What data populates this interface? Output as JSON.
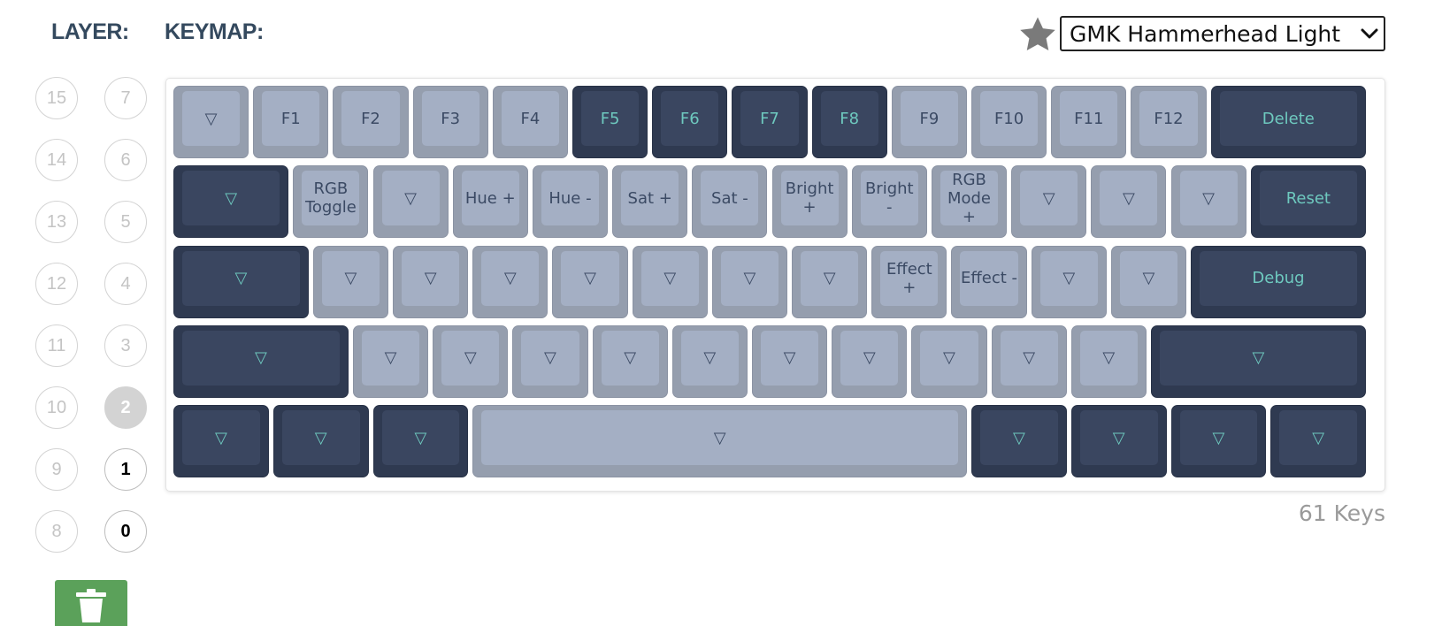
{
  "header": {
    "layer_label": "LAYER:",
    "keymap_label": "KEYMAP:"
  },
  "theme": {
    "selected": "GMK Hammerhead Light",
    "favorite_icon": "star-icon"
  },
  "layers": {
    "left_column": [
      "15",
      "14",
      "13",
      "12",
      "11",
      "10",
      "9",
      "8"
    ],
    "right_column": [
      "7",
      "6",
      "5",
      "4",
      "3",
      "2",
      "1",
      "0"
    ],
    "active": "2",
    "used": [
      "1",
      "0"
    ]
  },
  "actions": {
    "delete_icon": "trash-icon",
    "delete_color": "#5ba15a"
  },
  "colors": {
    "alpha_keys": "#a4afc4",
    "mod_keys": "#3a4660",
    "mod_legend": "#6ec9bf",
    "alpha_legend": "#3b4a64"
  },
  "keyboard": {
    "rows": [
      [
        {
          "label": "▽"
        },
        {
          "label": "F1"
        },
        {
          "label": "F2"
        },
        {
          "label": "F3"
        },
        {
          "label": "F4"
        },
        {
          "label": "F5",
          "dark": true
        },
        {
          "label": "F6",
          "dark": true
        },
        {
          "label": "F7",
          "dark": true
        },
        {
          "label": "F8",
          "dark": true
        },
        {
          "label": "F9"
        },
        {
          "label": "F10"
        },
        {
          "label": "F11"
        },
        {
          "label": "F12"
        },
        {
          "label": "Delete",
          "dark": true,
          "w": 2
        }
      ],
      [
        {
          "label": "▽",
          "dark": true,
          "w": 1.5
        },
        {
          "label": "RGB\nToggle"
        },
        {
          "label": "▽"
        },
        {
          "label": "Hue +"
        },
        {
          "label": "Hue -"
        },
        {
          "label": "Sat +"
        },
        {
          "label": "Sat -"
        },
        {
          "label": "Bright\n+"
        },
        {
          "label": "Bright\n-"
        },
        {
          "label": "RGB\nMode\n+"
        },
        {
          "label": "▽"
        },
        {
          "label": "▽"
        },
        {
          "label": "▽"
        },
        {
          "label": "Reset",
          "dark": true,
          "w": 1.5
        }
      ],
      [
        {
          "label": "▽",
          "dark": true,
          "w": 1.75
        },
        {
          "label": "▽"
        },
        {
          "label": "▽"
        },
        {
          "label": "▽"
        },
        {
          "label": "▽"
        },
        {
          "label": "▽"
        },
        {
          "label": "▽"
        },
        {
          "label": "▽"
        },
        {
          "label": "Effect\n+"
        },
        {
          "label": "Effect -"
        },
        {
          "label": "▽"
        },
        {
          "label": "▽"
        },
        {
          "label": "Debug",
          "dark": true,
          "w": 2.25
        }
      ],
      [
        {
          "label": "▽",
          "dark": true,
          "w": 2.25
        },
        {
          "label": "▽"
        },
        {
          "label": "▽"
        },
        {
          "label": "▽"
        },
        {
          "label": "▽"
        },
        {
          "label": "▽"
        },
        {
          "label": "▽"
        },
        {
          "label": "▽"
        },
        {
          "label": "▽"
        },
        {
          "label": "▽"
        },
        {
          "label": "▽"
        },
        {
          "label": "▽",
          "dark": true,
          "w": 2.75
        }
      ],
      [
        {
          "label": "▽",
          "dark": true,
          "w": 1.25
        },
        {
          "label": "▽",
          "dark": true,
          "w": 1.25
        },
        {
          "label": "▽",
          "dark": true,
          "w": 1.25
        },
        {
          "label": "▽",
          "w": 6.25
        },
        {
          "label": "▽",
          "dark": true,
          "w": 1.25
        },
        {
          "label": "▽",
          "dark": true,
          "w": 1.25
        },
        {
          "label": "▽",
          "dark": true,
          "w": 1.25
        },
        {
          "label": "▽",
          "dark": true,
          "w": 1.25
        }
      ]
    ]
  },
  "footer": {
    "key_count": "61 Keys"
  }
}
